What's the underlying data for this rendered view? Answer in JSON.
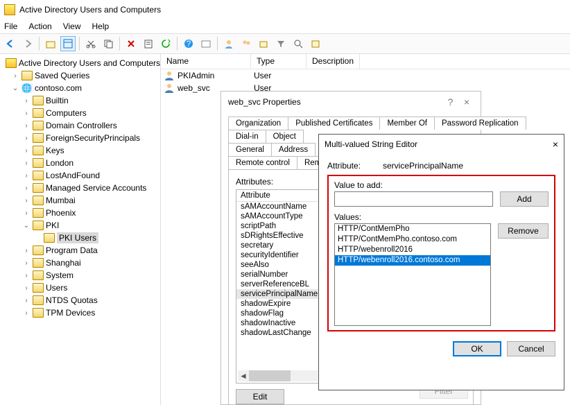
{
  "window": {
    "title": "Active Directory Users and Computers"
  },
  "menu": {
    "file": "File",
    "action": "Action",
    "view": "View",
    "help": "Help"
  },
  "tree": {
    "root": "Active Directory Users and Computers",
    "saved_queries": "Saved Queries",
    "domain": "contoso.com",
    "nodes": {
      "builtin": "Builtin",
      "computers": "Computers",
      "dcs": "Domain Controllers",
      "fsp": "ForeignSecurityPrincipals",
      "keys": "Keys",
      "london": "London",
      "laf": "LostAndFound",
      "msa": "Managed Service Accounts",
      "mumbai": "Mumbai",
      "phoenix": "Phoenix",
      "pki": "PKI",
      "pki_users": "PKI Users",
      "progdata": "Program Data",
      "shanghai": "Shanghai",
      "system": "System",
      "users": "Users",
      "ntds": "NTDS Quotas",
      "tpm": "TPM Devices"
    }
  },
  "list": {
    "cols": {
      "name": "Name",
      "type": "Type",
      "desc": "Description"
    },
    "rows": [
      {
        "name": "PKIAdmin",
        "type": "User"
      },
      {
        "name": "web_svc",
        "type": "User"
      }
    ]
  },
  "props": {
    "title": "web_svc Properties",
    "help": "?",
    "close": "×",
    "tabs": {
      "r1": [
        "Organization",
        "Published Certificates",
        "Member Of",
        "Password Replication"
      ],
      "r2": [
        "Dial-in",
        "Object"
      ],
      "r3": [
        "General",
        "Address"
      ],
      "r4": [
        "Remote control",
        "Remote D"
      ]
    },
    "attr_label": "Attributes:",
    "attr_header": "Attribute",
    "attrs": [
      "sAMAccountName",
      "sAMAccountType",
      "scriptPath",
      "sDRightsEffective",
      "secretary",
      "securityIdentifier",
      "seeAlso",
      "serialNumber",
      "serverReferenceBL",
      "servicePrincipalName",
      "shadowExpire",
      "shadowFlag",
      "shadowInactive",
      "shadowLastChange"
    ],
    "selected_attr": "servicePrincipalName",
    "edit": "Edit",
    "filter": "Filter"
  },
  "mv": {
    "title": "Multi-valued String Editor",
    "close": "×",
    "attr_label": "Attribute:",
    "attr_value": "servicePrincipalName",
    "value_to_add": "Value to add:",
    "add": "Add",
    "values_label": "Values:",
    "values": [
      "HTTP/ContMemPho",
      "HTTP/ContMemPho.contoso.com",
      "HTTP/webenroll2016",
      "HTTP/webenroll2016.contoso.com"
    ],
    "selected_value": "HTTP/webenroll2016.contoso.com",
    "remove": "Remove",
    "ok": "OK",
    "cancel": "Cancel"
  }
}
